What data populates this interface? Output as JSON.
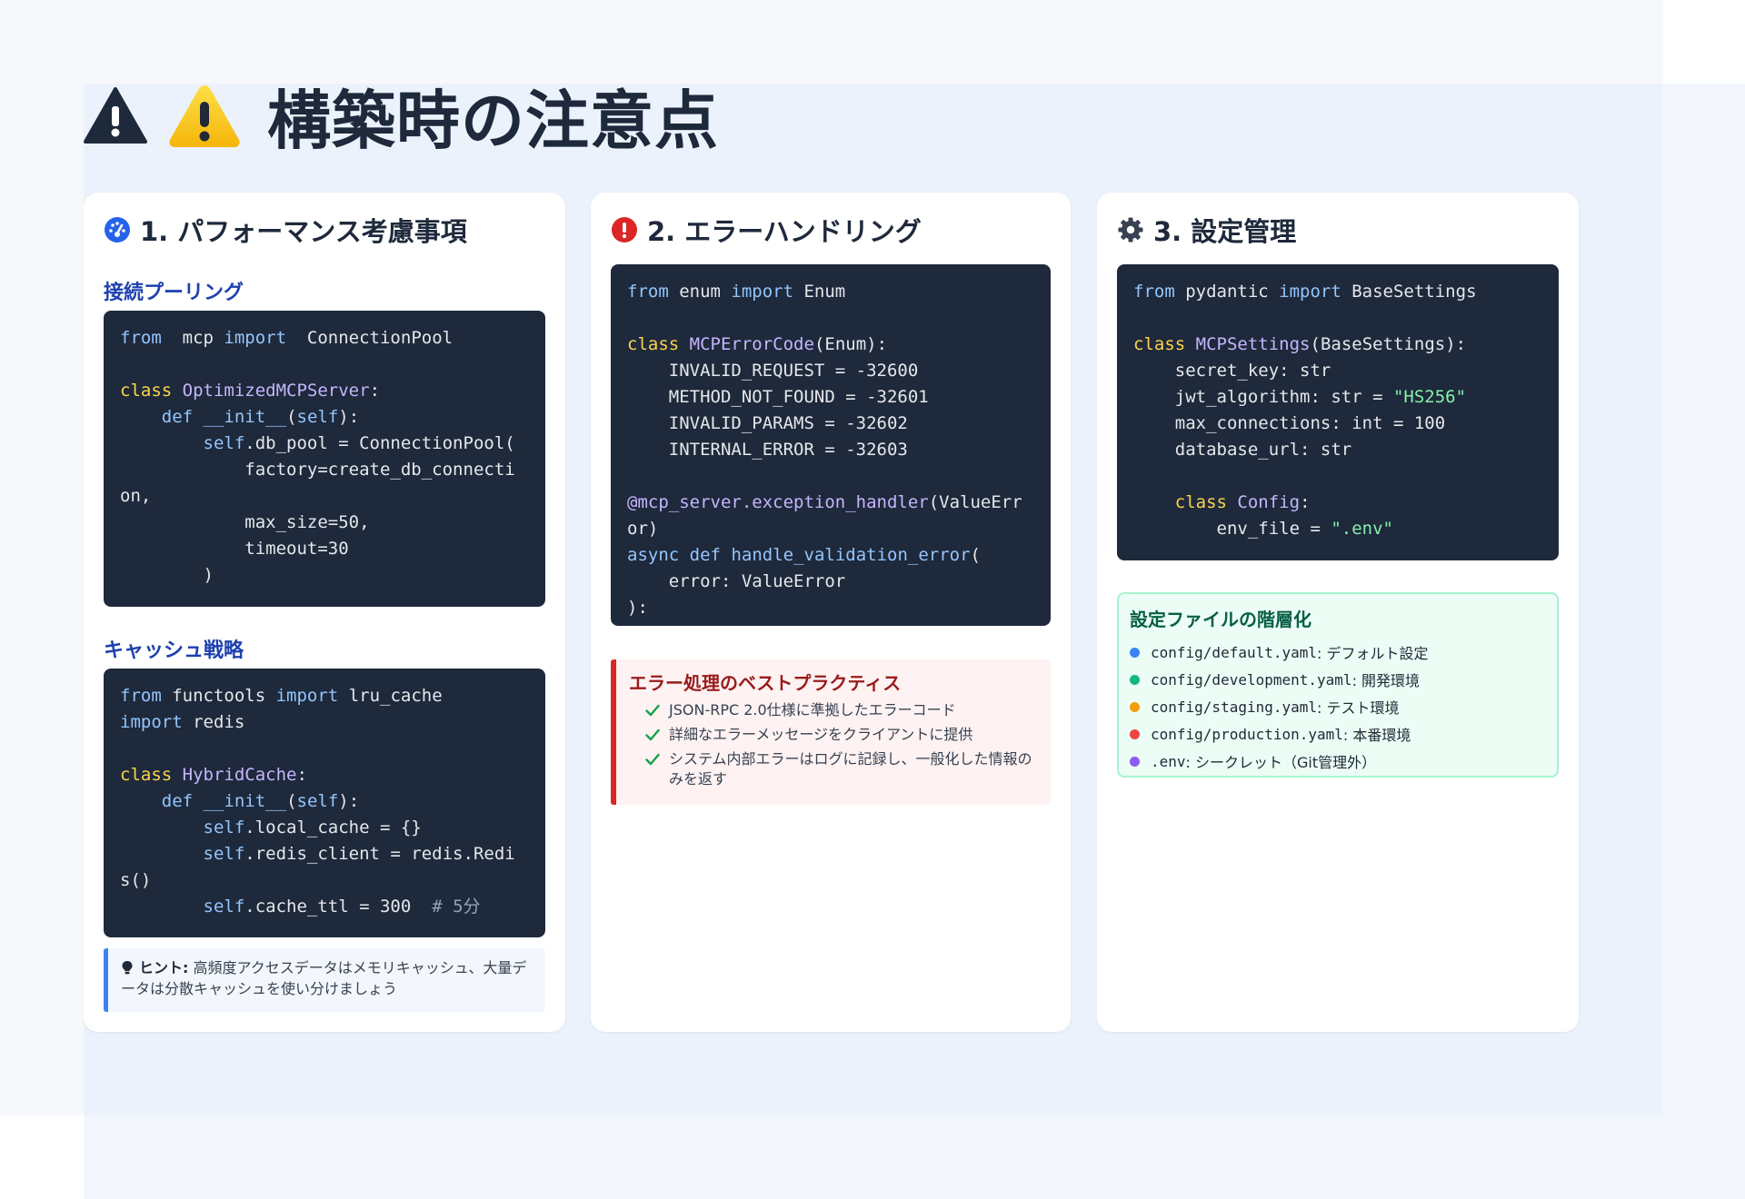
{
  "title": "構築時の注意点",
  "colors": {
    "accent": "#2563eb",
    "error": "#dc2626",
    "success": "#16a34a"
  },
  "cards": [
    {
      "title": "1. パフォーマンス考慮事項",
      "icon": "gauge-icon",
      "sections": [
        {
          "title": "接続プーリング",
          "code": [
            [
              [
                "kw",
                "from"
              ],
              [
                "",
                "  mcp "
              ],
              [
                "kw",
                "import"
              ],
              [
                "",
                "  ConnectionPool"
              ]
            ],
            [],
            [
              [
                "kw2",
                "class"
              ],
              [
                "",
                " "
              ],
              [
                "cls",
                "OptimizedMCPServer"
              ],
              [
                "",
                ":"
              ]
            ],
            [
              [
                "",
                "    "
              ],
              [
                "kw",
                "def"
              ],
              [
                "",
                " "
              ],
              [
                "kw",
                "__init__"
              ],
              [
                "",
                "("
              ],
              [
                "kw",
                "self"
              ],
              [
                "",
                "):"
              ]
            ],
            [
              [
                "",
                "        "
              ],
              [
                "kw",
                "self"
              ],
              [
                "",
                ".db_pool = ConnectionPool("
              ]
            ],
            [
              [
                "",
                "            factory=create_db_connecti"
              ]
            ],
            [
              [
                "",
                "on,"
              ]
            ],
            [
              [
                "",
                "            max_size=50,"
              ]
            ],
            [
              [
                "",
                "            timeout=30"
              ]
            ],
            [
              [
                "",
                "        )"
              ]
            ]
          ]
        },
        {
          "title": "キャッシュ戦略",
          "code": [
            [
              [
                "kw",
                "from"
              ],
              [
                "",
                " functools "
              ],
              [
                "kw",
                "import"
              ],
              [
                "",
                " lru_cache"
              ]
            ],
            [
              [
                "kw",
                "import"
              ],
              [
                "",
                " redis"
              ]
            ],
            [],
            [
              [
                "kw2",
                "class"
              ],
              [
                "",
                " "
              ],
              [
                "cls",
                "HybridCache"
              ],
              [
                "",
                ":"
              ]
            ],
            [
              [
                "",
                "    "
              ],
              [
                "kw",
                "def"
              ],
              [
                "",
                " "
              ],
              [
                "kw",
                "__init__"
              ],
              [
                "",
                "("
              ],
              [
                "kw",
                "self"
              ],
              [
                "",
                "):"
              ]
            ],
            [
              [
                "",
                "        "
              ],
              [
                "kw",
                "self"
              ],
              [
                "",
                ".local_cache = {}"
              ]
            ],
            [
              [
                "",
                "        "
              ],
              [
                "kw",
                "self"
              ],
              [
                "",
                ".redis_client = redis.Redi"
              ]
            ],
            [
              [
                "",
                "s()"
              ]
            ],
            [
              [
                "",
                "        "
              ],
              [
                "kw",
                "self"
              ],
              [
                "",
                ".cache_ttl = 300  "
              ],
              [
                "com",
                "# 5分"
              ]
            ]
          ]
        }
      ],
      "hint": {
        "label": "ヒント:",
        "text": " 高頻度アクセスデータはメモリキャッシュ、大量データは分散キャッシュを使い分けましょう"
      }
    },
    {
      "title": "2. エラーハンドリング",
      "icon": "error-circle-icon",
      "code": [
        [
          [
            "kw",
            "from"
          ],
          [
            "",
            " enum "
          ],
          [
            "kw",
            "import"
          ],
          [
            "",
            " Enum"
          ]
        ],
        [],
        [
          [
            "kw2",
            "class"
          ],
          [
            "",
            " "
          ],
          [
            "cls",
            "MCPErrorCode"
          ],
          [
            "",
            "(Enum):"
          ]
        ],
        [
          [
            "",
            "    INVALID_REQUEST = -32600"
          ]
        ],
        [
          [
            "",
            "    METHOD_NOT_FOUND = -32601"
          ]
        ],
        [
          [
            "",
            "    INVALID_PARAMS = -32602"
          ]
        ],
        [
          [
            "",
            "    INTERNAL_ERROR = -32603"
          ]
        ],
        [],
        [
          [
            "dec",
            "@mcp_server.exception_handler"
          ],
          [
            "",
            "(ValueErr"
          ]
        ],
        [
          [
            "",
            "or)"
          ]
        ],
        [
          [
            "kw",
            "async"
          ],
          [
            "",
            " "
          ],
          [
            "kw",
            "def"
          ],
          [
            "",
            " "
          ],
          [
            "kw",
            "handle_validation_error"
          ],
          [
            "",
            "("
          ]
        ],
        [
          [
            "",
            "    error: ValueError"
          ]
        ],
        [
          [
            "",
            "):"
          ]
        ]
      ],
      "best": {
        "title": "エラー処理のベストプラクティス",
        "items": [
          "JSON-RPC 2.0仕様に準拠したエラーコード",
          "詳細なエラーメッセージをクライアントに提供",
          "システム内部エラーはログに記録し、一般化した情報のみを返す"
        ]
      }
    },
    {
      "title": "3. 設定管理",
      "icon": "gear-icon",
      "code": [
        [
          [
            "kw",
            "from"
          ],
          [
            "",
            " pydantic "
          ],
          [
            "kw",
            "import"
          ],
          [
            "",
            " BaseSettings"
          ]
        ],
        [],
        [
          [
            "kw2",
            "class"
          ],
          [
            "",
            " "
          ],
          [
            "cls",
            "MCPSettings"
          ],
          [
            "",
            "(BaseSettings):"
          ]
        ],
        [
          [
            "",
            "    secret_key: str"
          ]
        ],
        [
          [
            "",
            "    jwt_algorithm: str = "
          ],
          [
            "str",
            "\"HS256\""
          ]
        ],
        [
          [
            "",
            "    max_connections: int = 100"
          ]
        ],
        [
          [
            "",
            "    database_url: str"
          ]
        ],
        [],
        [
          [
            "",
            "    "
          ],
          [
            "kw2",
            "class"
          ],
          [
            "",
            " "
          ],
          [
            "cls",
            "Config"
          ],
          [
            "",
            ":"
          ]
        ],
        [
          [
            "",
            "        env_file = "
          ],
          [
            "str",
            "\".env\""
          ]
        ]
      ],
      "layers": {
        "title": "設定ファイルの階層化",
        "items": [
          {
            "file": "config/default.yaml",
            "desc": ": デフォルト設定",
            "color": "#3b82f6"
          },
          {
            "file": "config/development.yaml",
            "desc": ": 開発環境",
            "color": "#10b981"
          },
          {
            "file": "config/staging.yaml",
            "desc": ": テスト環境",
            "color": "#f59e0b"
          },
          {
            "file": "config/production.yaml",
            "desc": ": 本番環境",
            "color": "#ef4444"
          },
          {
            "file": ".env",
            "desc": ": シークレット（Git管理外）",
            "color": "#8b5cf6"
          }
        ]
      }
    }
  ]
}
